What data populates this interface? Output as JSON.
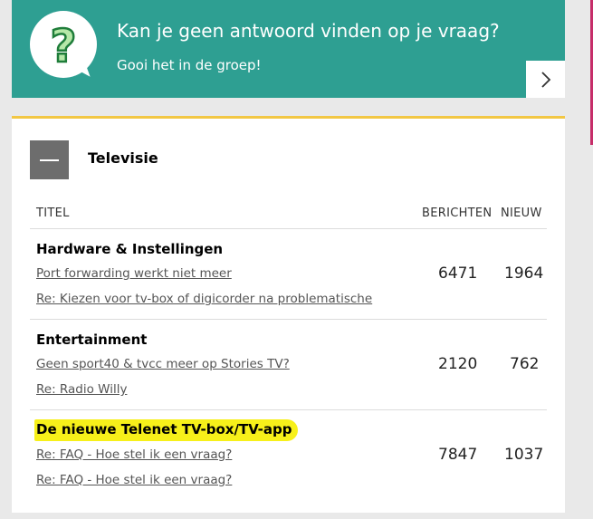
{
  "banner": {
    "title": "Kan je geen antwoord vinden op je vraag?",
    "subtitle": "Gooi het in de groep!",
    "icon": "question-bubble-icon",
    "arrow_icon": "chevron-right-icon",
    "color": "#2e9f92"
  },
  "section": {
    "title": "Televisie",
    "accent_color": "#f2c744",
    "columns": {
      "title": "TITEL",
      "posts": "BERICHTEN",
      "new": "NIEUW"
    },
    "rows": [
      {
        "name": "Hardware & Instellingen",
        "link1": "Port forwarding werkt niet meer",
        "link2": "Re: Kiezen voor tv-box of digicorder na problematische",
        "posts": "6471",
        "new": "1964"
      },
      {
        "name": "Entertainment",
        "link1": "Geen sport40 & tvcc meer op Stories TV?",
        "link2": "Re: Radio Willy",
        "posts": "2120",
        "new": "762"
      },
      {
        "name": "De nieuwe Telenet TV-box/TV-app",
        "link1": "Re: FAQ - Hoe stel ik een vraag?",
        "link2": "Re: FAQ - Hoe stel ik een vraag?",
        "posts": "7847",
        "new": "1037",
        "highlight_color": "#f7f01a"
      }
    ]
  }
}
